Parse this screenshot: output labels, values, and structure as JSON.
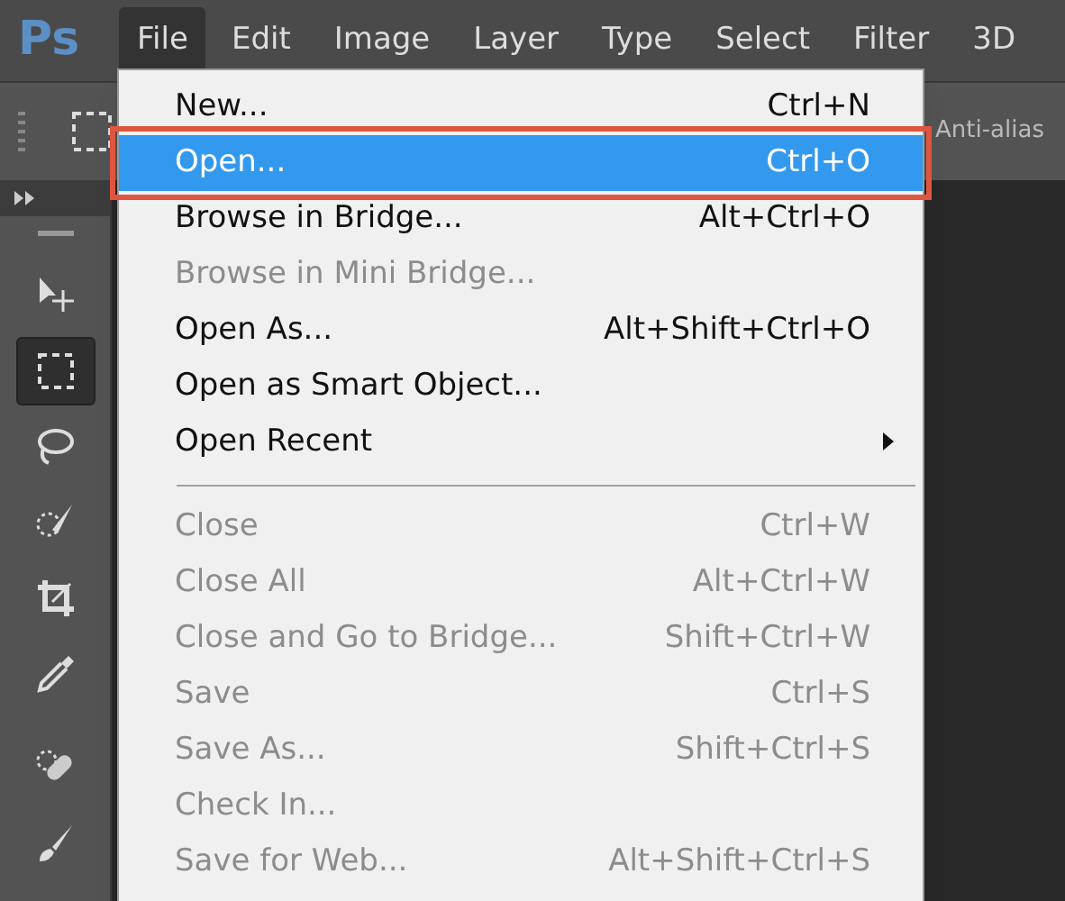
{
  "app_logo": "Ps",
  "menu_bar": [
    {
      "label": "File",
      "selected": true
    },
    {
      "label": "Edit",
      "selected": false
    },
    {
      "label": "Image",
      "selected": false
    },
    {
      "label": "Layer",
      "selected": false
    },
    {
      "label": "Type",
      "selected": false
    },
    {
      "label": "Select",
      "selected": false
    },
    {
      "label": "Filter",
      "selected": false
    },
    {
      "label": "3D",
      "selected": false
    }
  ],
  "options_bar": {
    "anti_alias_label": "Anti-alias"
  },
  "toolbar": {
    "tools": [
      {
        "selected": false
      },
      {
        "selected": true
      },
      {
        "selected": false
      },
      {
        "selected": false
      },
      {
        "selected": false
      },
      {
        "selected": false
      },
      {
        "selected": false
      },
      {
        "selected": false
      }
    ]
  },
  "file_menu": [
    {
      "kind": "item",
      "label": "New...",
      "shortcut": "Ctrl+N",
      "disabled": false,
      "selected": false
    },
    {
      "kind": "item",
      "label": "Open...",
      "shortcut": "Ctrl+O",
      "disabled": false,
      "selected": true
    },
    {
      "kind": "item",
      "label": "Browse in Bridge...",
      "shortcut": "Alt+Ctrl+O",
      "disabled": false,
      "selected": false
    },
    {
      "kind": "item",
      "label": "Browse in Mini Bridge...",
      "disabled": true,
      "selected": false
    },
    {
      "kind": "item",
      "label": "Open As...",
      "shortcut": "Alt+Shift+Ctrl+O",
      "disabled": false,
      "selected": false
    },
    {
      "kind": "item",
      "label": "Open as Smart Object...",
      "disabled": false,
      "selected": false
    },
    {
      "kind": "item",
      "label": "Open Recent",
      "disabled": false,
      "selected": false,
      "submenu": true
    },
    {
      "kind": "separator"
    },
    {
      "kind": "item",
      "label": "Close",
      "shortcut": "Ctrl+W",
      "disabled": true,
      "selected": false
    },
    {
      "kind": "item",
      "label": "Close All",
      "shortcut": "Alt+Ctrl+W",
      "disabled": true,
      "selected": false
    },
    {
      "kind": "item",
      "label": "Close and Go to Bridge...",
      "shortcut": "Shift+Ctrl+W",
      "disabled": true,
      "selected": false
    },
    {
      "kind": "item",
      "label": "Save",
      "shortcut": "Ctrl+S",
      "disabled": true,
      "selected": false
    },
    {
      "kind": "item",
      "label": "Save As...",
      "shortcut": "Shift+Ctrl+S",
      "disabled": true,
      "selected": false
    },
    {
      "kind": "item",
      "label": "Check In...",
      "disabled": true,
      "selected": false
    },
    {
      "kind": "item",
      "label": "Save for Web...",
      "shortcut": "Alt+Shift+Ctrl+S",
      "disabled": true,
      "selected": false
    }
  ]
}
